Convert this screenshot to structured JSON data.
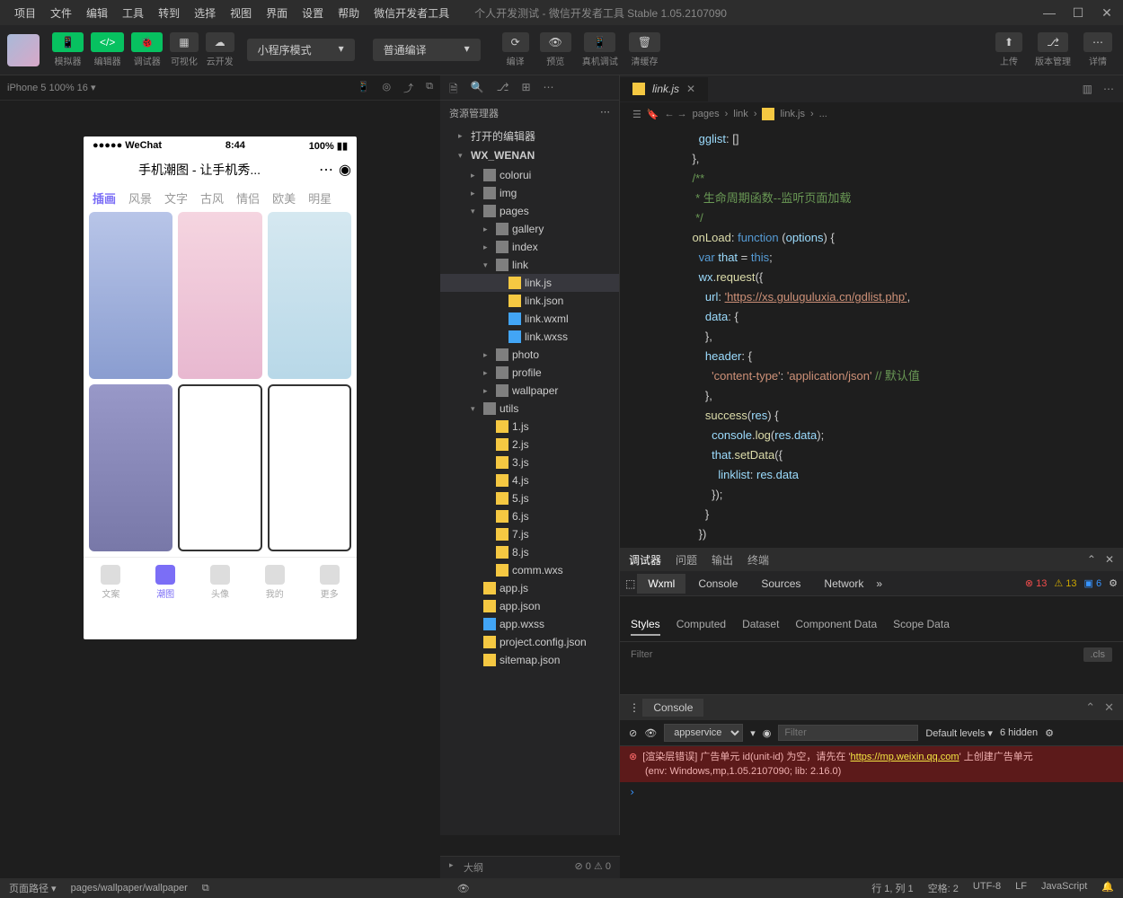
{
  "menubar": [
    "项目",
    "文件",
    "编辑",
    "工具",
    "转到",
    "选择",
    "视图",
    "界面",
    "设置",
    "帮助",
    "微信开发者工具"
  ],
  "window_title": "个人开发测试 - 微信开发者工具 Stable 1.05.2107090",
  "toolbar": {
    "mode_buttons": [
      {
        "icon": "📱",
        "label": "模拟器"
      },
      {
        "icon": "</>",
        "label": "编辑器"
      },
      {
        "icon": "🐞",
        "label": "调试器"
      }
    ],
    "gray_buttons": [
      {
        "icon": "▦",
        "label": "可视化"
      },
      {
        "icon": "☁",
        "label": "云开发"
      }
    ],
    "mode_dropdown": "小程序模式",
    "compile_dropdown": "普通编译",
    "compile_actions": [
      {
        "icon": "⟳",
        "label": "编译"
      },
      {
        "icon": "👁",
        "label": "预览"
      },
      {
        "icon": "📱",
        "label": "真机调试"
      },
      {
        "icon": "🗑",
        "label": "清缓存"
      }
    ],
    "right_actions": [
      {
        "icon": "⬆",
        "label": "上传"
      },
      {
        "icon": "⎇",
        "label": "版本管理"
      },
      {
        "icon": "⋯",
        "label": "详情"
      }
    ]
  },
  "simulator": {
    "device_info": "iPhone 5 100% 16 ▾",
    "status_left": "●●●●● WeChat",
    "status_time": "8:44",
    "status_right": "100%",
    "app_title": "手机潮图 - 让手机秀...",
    "category_tabs": [
      "插画",
      "风景",
      "文字",
      "古风",
      "情侣",
      "欧美",
      "明星"
    ],
    "bottom_nav": [
      "文案",
      "潮图",
      "头像",
      "我的",
      "更多"
    ]
  },
  "explorer": {
    "title": "资源管理器",
    "sections": [
      {
        "label": "打开的编辑器",
        "expanded": false
      },
      {
        "label": "WX_WENAN",
        "expanded": true
      }
    ],
    "tree": [
      {
        "t": "folder",
        "name": "colorui",
        "d": 1
      },
      {
        "t": "folder",
        "name": "img",
        "d": 1
      },
      {
        "t": "folder",
        "name": "pages",
        "d": 1,
        "open": true
      },
      {
        "t": "folder",
        "name": "gallery",
        "d": 2
      },
      {
        "t": "folder",
        "name": "index",
        "d": 2
      },
      {
        "t": "folder",
        "name": "link",
        "d": 2,
        "open": true
      },
      {
        "t": "js",
        "name": "link.js",
        "d": 3,
        "sel": true
      },
      {
        "t": "json",
        "name": "link.json",
        "d": 3
      },
      {
        "t": "wxml",
        "name": "link.wxml",
        "d": 3
      },
      {
        "t": "wxss",
        "name": "link.wxss",
        "d": 3
      },
      {
        "t": "folder",
        "name": "photo",
        "d": 2
      },
      {
        "t": "folder",
        "name": "profile",
        "d": 2
      },
      {
        "t": "folder",
        "name": "wallpaper",
        "d": 2
      },
      {
        "t": "folder",
        "name": "utils",
        "d": 1,
        "open": true
      },
      {
        "t": "js",
        "name": "1.js",
        "d": 2
      },
      {
        "t": "js",
        "name": "2.js",
        "d": 2
      },
      {
        "t": "js",
        "name": "3.js",
        "d": 2
      },
      {
        "t": "js",
        "name": "4.js",
        "d": 2
      },
      {
        "t": "js",
        "name": "5.js",
        "d": 2
      },
      {
        "t": "js",
        "name": "6.js",
        "d": 2
      },
      {
        "t": "js",
        "name": "7.js",
        "d": 2
      },
      {
        "t": "js",
        "name": "8.js",
        "d": 2
      },
      {
        "t": "wxs",
        "name": "comm.wxs",
        "d": 2
      },
      {
        "t": "js",
        "name": "app.js",
        "d": 1
      },
      {
        "t": "json",
        "name": "app.json",
        "d": 1
      },
      {
        "t": "wxss",
        "name": "app.wxss",
        "d": 1
      },
      {
        "t": "json",
        "name": "project.config.json",
        "d": 1
      },
      {
        "t": "json",
        "name": "sitemap.json",
        "d": 1
      }
    ]
  },
  "editor": {
    "tab_name": "link.js",
    "breadcrumb": [
      "pages",
      "link",
      "link.js",
      "..."
    ],
    "code_lines": [
      {
        "i": 4,
        "h": "      <span class='prop'>gglist</span><span class='pun'>: []</span>"
      },
      {
        "i": 5,
        "h": "    <span class='pun'>},</span>"
      },
      {
        "i": 6,
        "h": ""
      },
      {
        "i": 7,
        "h": "    <span class='com'>/**</span>"
      },
      {
        "i": 8,
        "h": "    <span class='com'> * 生命周期函数--监听页面加载</span>"
      },
      {
        "i": 9,
        "h": "    <span class='com'> */</span>"
      },
      {
        "i": 10,
        "h": "    <span class='fn'>onLoad</span><span class='pun'>: </span><span class='kw'>function</span> <span class='pun'>(</span><span class='prop'>options</span><span class='pun'>) {</span>"
      },
      {
        "i": 11,
        "h": "      <span class='kw'>var</span> <span class='prop'>that</span> <span class='pun'>=</span> <span class='this'>this</span><span class='pun'>;</span>"
      },
      {
        "i": 12,
        "h": "      <span class='prop'>wx</span><span class='pun'>.</span><span class='fn'>request</span><span class='pun'>({</span>"
      },
      {
        "i": 13,
        "h": "        <span class='prop'>url</span><span class='pun'>: </span><span class='str-url'>'https://xs.guluguluxia.cn/gdlist.php'</span><span class='pun'>,</span>"
      },
      {
        "i": 14,
        "h": "        <span class='prop'>data</span><span class='pun'>: {</span>"
      },
      {
        "i": 15,
        "h": "        <span class='pun'>},</span>"
      },
      {
        "i": 16,
        "h": "        <span class='prop'>header</span><span class='pun'>: {</span>"
      },
      {
        "i": 17,
        "h": "          <span class='str'>'content-type'</span><span class='pun'>: </span><span class='str'>'application/json'</span> <span class='com'>// 默认值</span>"
      },
      {
        "i": 18,
        "h": "        <span class='pun'>},</span>"
      },
      {
        "i": 19,
        "h": "        <span class='fn'>success</span><span class='pun'>(</span><span class='prop'>res</span><span class='pun'>) {</span>"
      },
      {
        "i": 20,
        "h": "          <span class='prop'>console</span><span class='pun'>.</span><span class='fn'>log</span><span class='pun'>(</span><span class='prop'>res</span><span class='pun'>.</span><span class='prop'>data</span><span class='pun'>);</span>"
      },
      {
        "i": 21,
        "h": "          <span class='prop'>that</span><span class='pun'>.</span><span class='fn'>setData</span><span class='pun'>({</span>"
      },
      {
        "i": 22,
        "h": "            <span class='prop'>linklist</span><span class='pun'>: </span><span class='prop'>res</span><span class='pun'>.</span><span class='prop'>data</span>"
      },
      {
        "i": 23,
        "h": "          <span class='pun'>});</span>"
      },
      {
        "i": 24,
        "h": "        <span class='pun'>}</span>"
      },
      {
        "i": 25,
        "h": "      <span class='pun'>})</span>"
      }
    ]
  },
  "devtools": {
    "top_tabs": [
      "调试器",
      "问题",
      "输出",
      "终端"
    ],
    "panel_tabs": [
      "Wxml",
      "Console",
      "Sources",
      "Network"
    ],
    "badges": {
      "err": "13",
      "warn": "13",
      "info": "6"
    },
    "style_tabs": [
      "Styles",
      "Computed",
      "Dataset",
      "Component Data",
      "Scope Data"
    ],
    "filter_placeholder": "Filter",
    "cls_label": ".cls"
  },
  "console": {
    "tab": "Console",
    "context": "appservice",
    "filter_placeholder": "Filter",
    "levels": "Default levels ▾",
    "hidden": "6 hidden",
    "error_line1_prefix": "[渲染层错误] 广告单元 id(unit-id) 为空，请先在 '",
    "error_link": "https://mp.weixin.qq.com",
    "error_line1_suffix": "' 上创建广告单元",
    "error_line2": "(env: Windows,mp,1.05.2107090; lib: 2.16.0)"
  },
  "outline": {
    "label": "大纲",
    "problems": "⊘ 0 ⚠ 0"
  },
  "statusbar": {
    "left_label": "页面路径 ▾",
    "path": "pages/wallpaper/wallpaper",
    "pos": "行 1, 列 1",
    "spaces": "空格: 2",
    "encoding": "UTF-8",
    "eol": "LF",
    "lang": "JavaScript"
  }
}
